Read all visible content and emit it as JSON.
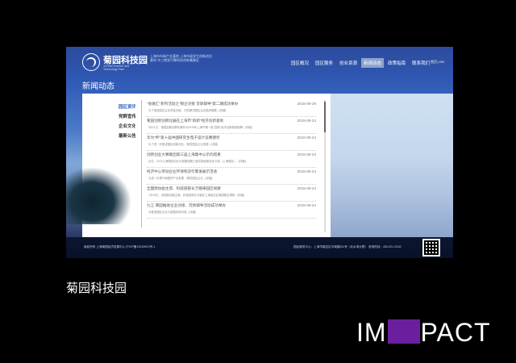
{
  "site": {
    "logo_cn": "菊园科技园",
    "logo_en": "JuYuan Science and Technology Park",
    "tagline": "上海市市新产业基地 上海市留学生创新创业基地 市三期双引擎科技创新集聚区"
  },
  "nav": {
    "items": [
      {
        "label": "园区概况",
        "active": false
      },
      {
        "label": "园区服务",
        "active": false
      },
      {
        "label": "创业资源",
        "active": false
      },
      {
        "label": "新闻动态",
        "active": true
      },
      {
        "label": "政策指南",
        "active": false
      },
      {
        "label": "联系我们",
        "active": false
      }
    ],
    "lang": "首页 | EN"
  },
  "page_title": "新闻动态",
  "sidebar": {
    "items": [
      {
        "label": "园区资讯",
        "active": true
      },
      {
        "label": "党群宣传",
        "active": false
      },
      {
        "label": "企业文化",
        "active": false
      },
      {
        "label": "最新公告",
        "active": false
      }
    ]
  },
  "news": [
    {
      "title": "\"会融汇\"系列活动之\"银企对接 贷款辅导\"第二期成功举办",
      "date": "2015-09-29",
      "summary": "为了促进园区企业资金对接，切实解决园区企业融资难题...[详细]"
    },
    {
      "title": "菊园创新创孵化器在上海市\"四新\"经济创新基地",
      "date": "2015-09-24",
      "summary": "9月11日，菊园创新创孵化器作为2015年上海市第一批\"四新\"经济创新基地授牌...[详细]"
    },
    {
      "title": "华为\"杯\"第十届中国研究生电子设计竞赛颁奖",
      "date": "2015-09-24",
      "summary": "为了进一步推进园区创新创业，服务园区企业发展...[详细]"
    },
    {
      "title": "创新创业大赛集团第三届上海集中公示的结果",
      "date": "2015-09-24",
      "summary": "近日，2015上海国际创业大赛集团第三届中国创新创业大赛（上海赛区）...[详细]"
    },
    {
      "title": "经济中心带动企业环保和双引擎发展示范会",
      "date": "2015-09-24",
      "summary": "为进一步提升菊园的产业发展，服务园区企业...[详细]"
    },
    {
      "title": "全国政协副主席、科技部部长万钢来园区视察",
      "date": "2015-09-24",
      "summary": "7月15日，全国政协副主席、科技部部长万钢在上海嘉定区菊园新区调研...[详细]"
    },
    {
      "title": "九江·菊园推进企业对接、贷款辅导活动成功举办",
      "date": "2015-09-24",
      "summary": "为推进园区企业与金融机构对接...[详细]"
    }
  ],
  "footer": {
    "left": "版权所有 上海菊园经济发展中心 沪ICP备13018912号-1",
    "right": "园区服务中心：上海市嘉定区平城路811号（北水湾大厦）   咨询热线：400-021-3318"
  },
  "caption": "菊园科技园",
  "brand": {
    "before": "IM",
    "after": "PACT"
  }
}
